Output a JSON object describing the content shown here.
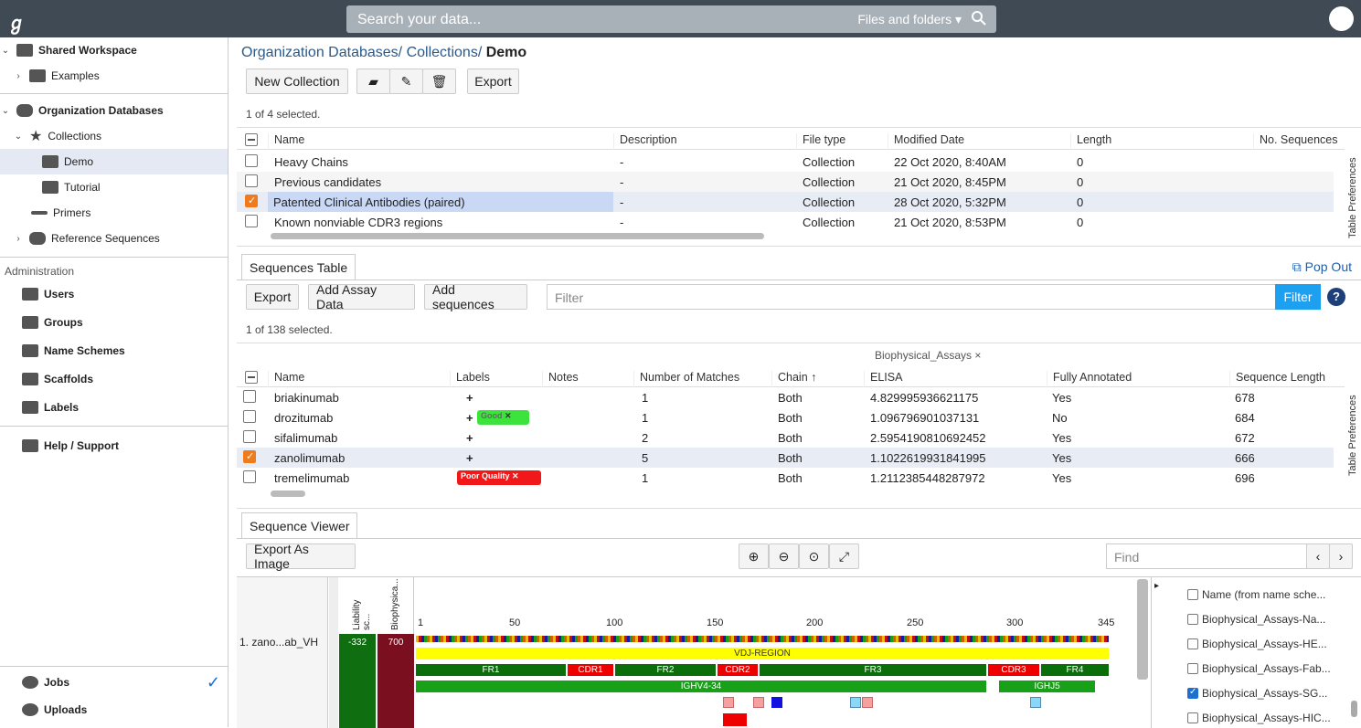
{
  "search": {
    "placeholder": "Search your data...",
    "scope": "Files and folders"
  },
  "sidebar": {
    "items": [
      {
        "label": "Shared Workspace"
      },
      {
        "label": "Examples"
      },
      {
        "label": "Organization Databases"
      },
      {
        "label": "Collections"
      },
      {
        "label": "Demo"
      },
      {
        "label": "Tutorial"
      },
      {
        "label": "Primers"
      },
      {
        "label": "Reference Sequences"
      }
    ],
    "admin_title": "Administration",
    "admin": [
      {
        "label": "Users"
      },
      {
        "label": "Groups"
      },
      {
        "label": "Name Schemes"
      },
      {
        "label": "Scaffolds"
      },
      {
        "label": "Labels"
      }
    ],
    "help": "Help / Support",
    "jobs": "Jobs",
    "uploads": "Uploads"
  },
  "breadcrumb": {
    "a": "Organization Databases/",
    "b": "Collections/",
    "c": "Demo"
  },
  "toolbar": {
    "new_collection": "New Collection",
    "export": "Export"
  },
  "collections": {
    "selected": "1 of 4 selected.",
    "headers": [
      "Name",
      "Description",
      "File type",
      "Modified Date",
      "Length",
      "No. Sequences"
    ],
    "rows": [
      [
        "Heavy Chains",
        "-",
        "Collection",
        "22 Oct 2020, 8:40AM",
        "0"
      ],
      [
        "Previous candidates",
        "-",
        "Collection",
        "21 Oct 2020, 8:45PM",
        "0"
      ],
      [
        "Patented Clinical Antibodies (paired)",
        "-",
        "Collection",
        "28 Oct 2020, 5:32PM",
        "0"
      ],
      [
        "Known nonviable CDR3 regions",
        "-",
        "Collection",
        "21 Oct 2020, 8:53PM",
        "0"
      ]
    ],
    "table_prefs": "Table Preferences"
  },
  "sequences": {
    "tab": "Sequences Table",
    "popout": "Pop Out",
    "export": "Export",
    "add_assay": "Add Assay Data",
    "add_seq": "Add sequences",
    "filter_placeholder": "Filter",
    "filter_btn": "Filter",
    "selected": "1 of 138 selected.",
    "group_header": "Biophysical_Assays",
    "headers": [
      "Name",
      "Labels",
      "Notes",
      "Number of Matches",
      "Chain",
      "ELISA",
      "Fully Annotated",
      "Sequence Length"
    ],
    "rows": [
      [
        "briakinumab",
        "1",
        "Both",
        "4.829995936621175",
        "Yes",
        "678"
      ],
      [
        "drozitumab",
        "1",
        "Both",
        "1.096796901037131",
        "No",
        "684"
      ],
      [
        "sifalimumab",
        "2",
        "Both",
        "2.5954190810692452",
        "Yes",
        "672"
      ],
      [
        "zanolimumab",
        "5",
        "Both",
        "1.1022619931841995",
        "Yes",
        "666"
      ],
      [
        "tremelimumab",
        "1",
        "Both",
        "1.2112385448287972",
        "Yes",
        "696"
      ]
    ],
    "tag_good": "Good",
    "tag_poor": "Poor Quality",
    "table_prefs": "Table Preferences"
  },
  "viewer": {
    "tab": "Sequence Viewer",
    "export_img": "Export As Image",
    "find_placeholder": "Find",
    "col1": "Liability sc...",
    "col2": "Biophysica...",
    "seq_name": "1. zano...ab_VH",
    "v1": "-332",
    "v2": "700",
    "ticks": [
      "1",
      "50",
      "100",
      "150",
      "200",
      "250",
      "300",
      "345"
    ],
    "region": "VDJ-REGION",
    "fr1": "FR1",
    "cdr1": "CDR1",
    "fr2": "FR2",
    "cdr2": "CDR2",
    "fr3": "FR3",
    "cdr3": "CDR3",
    "fr4": "FR4",
    "ighv": "IGHV4-34",
    "ighj": "IGHJ5",
    "panel": [
      {
        "label": "Name (from name sche...",
        "on": false
      },
      {
        "label": "Biophysical_Assays-Na...",
        "on": false
      },
      {
        "label": "Biophysical_Assays-HE...",
        "on": false
      },
      {
        "label": "Biophysical_Assays-Fab...",
        "on": false
      },
      {
        "label": "Biophysical_Assays-SG...",
        "on": true
      },
      {
        "label": "Biophysical_Assays-HIC...",
        "on": false
      }
    ]
  }
}
